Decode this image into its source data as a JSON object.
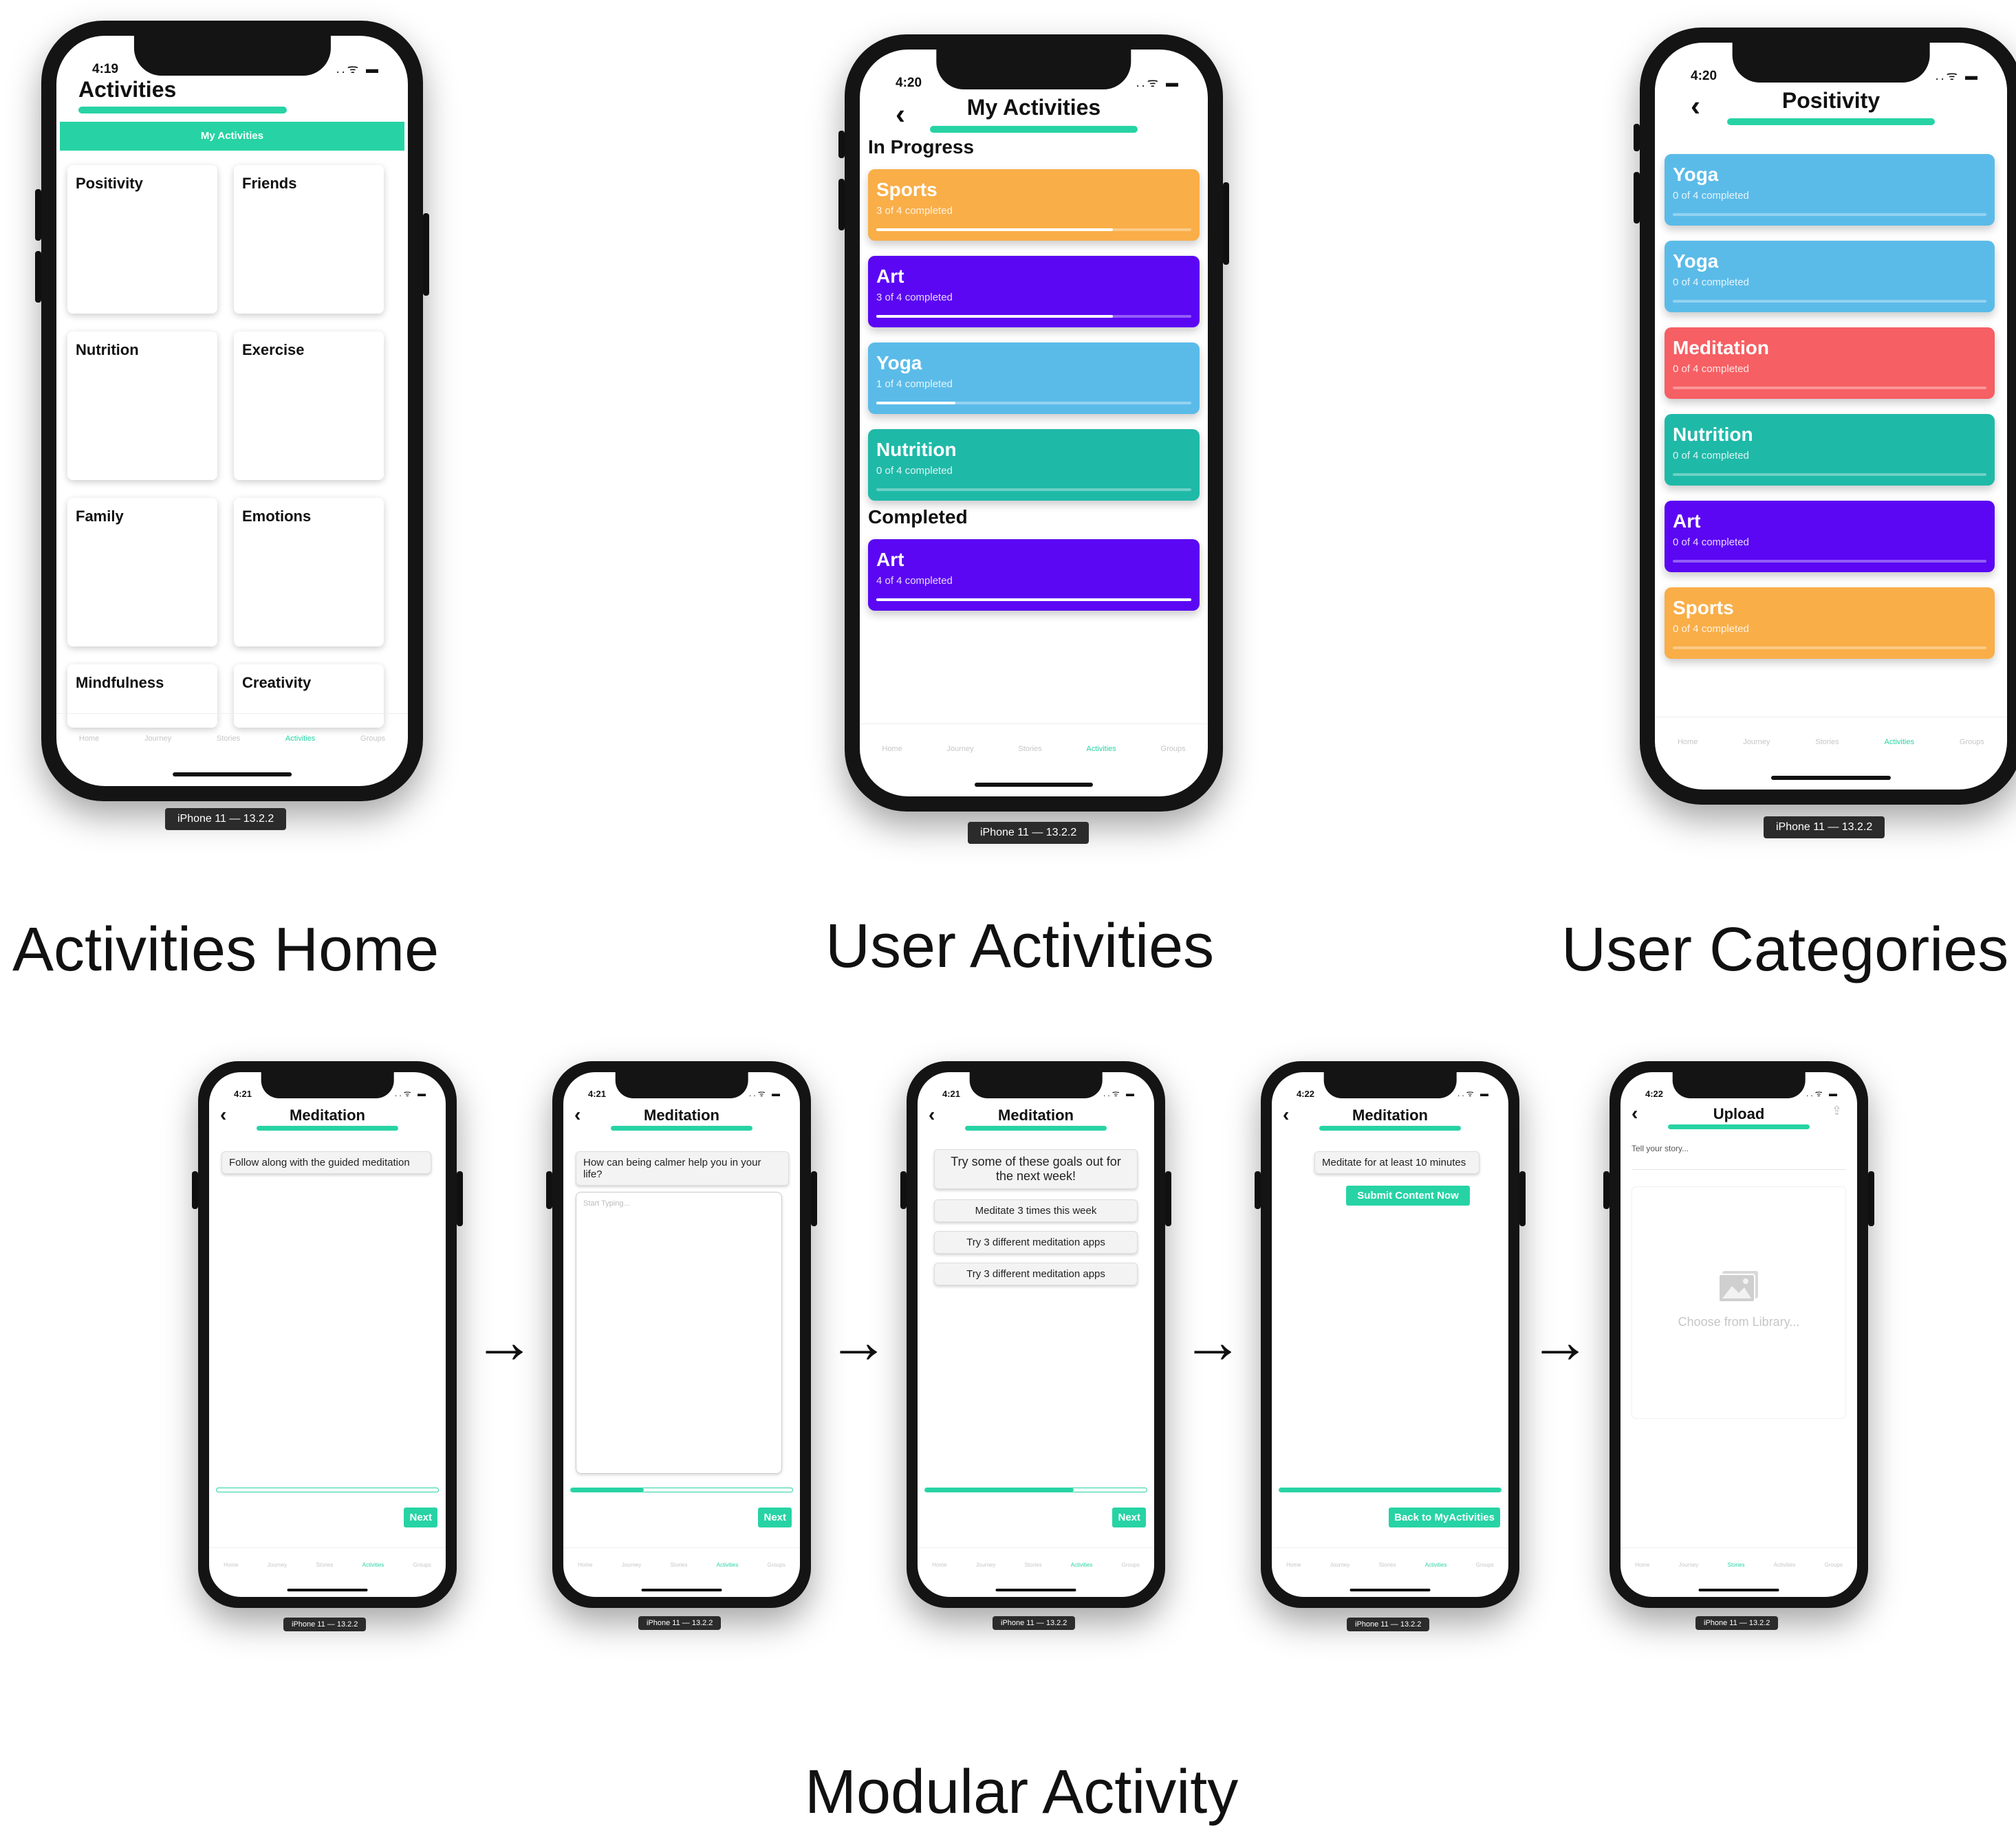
{
  "colors": {
    "accent": "#27d3a4",
    "orange": "#f9ae48",
    "purple": "#5b07f3",
    "blue": "#5bbbe8",
    "teal": "#1fb9a8",
    "red": "#f65f63"
  },
  "device_label": "iPhone 11 — 13.2.2",
  "tabs": [
    "Home",
    "Journey",
    "Stories",
    "Activities",
    "Groups"
  ],
  "captions": {
    "home": "Activities Home",
    "user_activities": "User Activities",
    "user_categories": "User Categories",
    "modular": "Modular Activity"
  },
  "arrow": "→",
  "back": "‹",
  "status_icons": "..ᯤ ▬",
  "screen1": {
    "time": "4:19",
    "title": "Activities",
    "my_activities_button": "My Activities",
    "tiles": [
      "Positivity",
      "Friends",
      "Nutrition",
      "Exercise",
      "Family",
      "Emotions",
      "Mindfulness",
      "Creativity"
    ]
  },
  "screen2": {
    "time": "4:20",
    "title": "My Activities",
    "in_progress": "In Progress",
    "completed": "Completed",
    "in_progress_items": [
      {
        "name": "Sports",
        "progress": "3 of 4 completed",
        "color": "orange",
        "fraction": 0.75
      },
      {
        "name": "Art",
        "progress": "3 of 4 completed",
        "color": "purple",
        "fraction": 0.75
      },
      {
        "name": "Yoga",
        "progress": "1 of 4 completed",
        "color": "blue",
        "fraction": 0.25
      },
      {
        "name": "Nutrition",
        "progress": "0 of 4 completed",
        "color": "teal",
        "fraction": 0
      }
    ],
    "completed_items": [
      {
        "name": "Art",
        "progress": "4 of 4 completed",
        "color": "purple",
        "fraction": 1
      }
    ]
  },
  "screen3": {
    "time": "4:20",
    "title": "Positivity",
    "items": [
      {
        "name": "Yoga",
        "progress": "0 of 4 completed",
        "color": "blue",
        "fraction": 0
      },
      {
        "name": "Yoga",
        "progress": "0 of 4 completed",
        "color": "blue",
        "fraction": 0
      },
      {
        "name": "Meditation",
        "progress": "0 of 4 completed",
        "color": "red",
        "fraction": 0
      },
      {
        "name": "Nutrition",
        "progress": "0 of 4 completed",
        "color": "teal",
        "fraction": 0
      },
      {
        "name": "Art",
        "progress": "0 of 4 completed",
        "color": "purple",
        "fraction": 0
      },
      {
        "name": "Sports",
        "progress": "0 of 4 completed",
        "color": "orange",
        "fraction": 0
      }
    ]
  },
  "mod1": {
    "time": "4:21",
    "title": "Meditation",
    "prompt": "Follow along with the guided meditation",
    "next": "Next",
    "progress": 0
  },
  "mod2": {
    "time": "4:21",
    "title": "Meditation",
    "prompt": "How can being calmer help you in your life?",
    "placeholder": "Start Typing...",
    "next": "Next",
    "progress": 0.33
  },
  "mod3": {
    "time": "4:21",
    "title": "Meditation",
    "prompt": "Try some of these goals out for the next week!",
    "goals": [
      "Meditate 3 times this week",
      "Try 3 different meditation apps",
      "Try 3 different meditation apps"
    ],
    "next": "Next",
    "progress": 0.67
  },
  "mod4": {
    "time": "4:22",
    "title": "Meditation",
    "prompt": "Meditate for at least 10 minutes",
    "submit": "Submit Content Now",
    "back_button": "Back to MyActivities",
    "progress": 1
  },
  "mod5": {
    "time": "4:22",
    "title": "Upload",
    "upload_icon": "⇪",
    "story_placeholder": "Tell your story...",
    "choose": "Choose from Library..."
  }
}
